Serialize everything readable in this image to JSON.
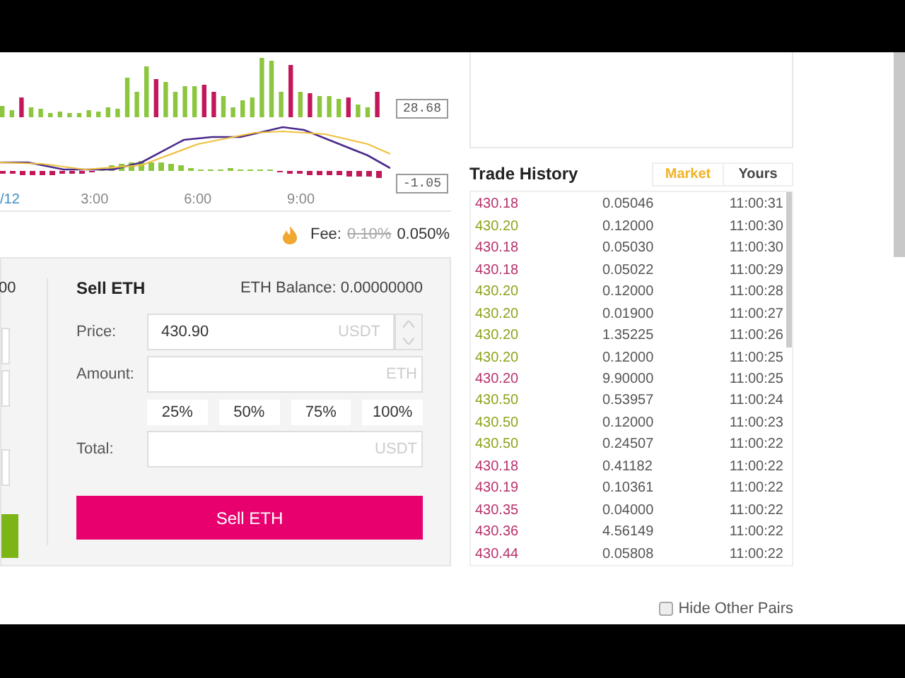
{
  "chart": {
    "price_labels": [
      "28.68",
      "-1.05"
    ],
    "time_labels": [
      "/12",
      "3:00",
      "6:00",
      "9:00"
    ]
  },
  "fee": {
    "label": "Fee:",
    "old": "0.10%",
    "new": "0.050%"
  },
  "buy": {
    "balance_fragment": "00"
  },
  "sell": {
    "title": "Sell ETH",
    "balance": "ETH Balance: 0.00000000",
    "price_label": "Price:",
    "price_value": "430.90",
    "price_unit": "USDT",
    "amount_label": "Amount:",
    "amount_unit": "ETH",
    "percents": [
      "25%",
      "50%",
      "75%",
      "100%"
    ],
    "total_label": "Total:",
    "total_unit": "USDT",
    "button": "Sell ETH"
  },
  "trade_history": {
    "title": "Trade History",
    "tabs": [
      {
        "label": "Market",
        "selected": true
      },
      {
        "label": "Yours",
        "selected": false
      }
    ],
    "rows": [
      {
        "price": "430.18",
        "amount": "0.05046",
        "time": "11:00:31",
        "color": "#b8326e"
      },
      {
        "price": "430.20",
        "amount": "0.12000",
        "time": "11:00:30",
        "color": "#8ea31c"
      },
      {
        "price": "430.18",
        "amount": "0.05030",
        "time": "11:00:30",
        "color": "#b8326e"
      },
      {
        "price": "430.18",
        "amount": "0.05022",
        "time": "11:00:29",
        "color": "#b8326e"
      },
      {
        "price": "430.20",
        "amount": "0.12000",
        "time": "11:00:28",
        "color": "#8ea31c"
      },
      {
        "price": "430.20",
        "amount": "0.01900",
        "time": "11:00:27",
        "color": "#8ea31c"
      },
      {
        "price": "430.20",
        "amount": "1.35225",
        "time": "11:00:26",
        "color": "#8ea31c"
      },
      {
        "price": "430.20",
        "amount": "0.12000",
        "time": "11:00:25",
        "color": "#8ea31c"
      },
      {
        "price": "430.20",
        "amount": "9.90000",
        "time": "11:00:25",
        "color": "#b8326e"
      },
      {
        "price": "430.50",
        "amount": "0.53957",
        "time": "11:00:24",
        "color": "#8ea31c"
      },
      {
        "price": "430.50",
        "amount": "0.12000",
        "time": "11:00:23",
        "color": "#8ea31c"
      },
      {
        "price": "430.50",
        "amount": "0.24507",
        "time": "11:00:22",
        "color": "#8ea31c"
      },
      {
        "price": "430.18",
        "amount": "0.41182",
        "time": "11:00:22",
        "color": "#b8326e"
      },
      {
        "price": "430.19",
        "amount": "0.10361",
        "time": "11:00:22",
        "color": "#b8326e"
      },
      {
        "price": "430.35",
        "amount": "0.04000",
        "time": "11:00:22",
        "color": "#b8326e"
      },
      {
        "price": "430.36",
        "amount": "4.56149",
        "time": "11:00:22",
        "color": "#b8326e"
      },
      {
        "price": "430.44",
        "amount": "0.05808",
        "time": "11:00:22",
        "color": "#b8326e"
      }
    ]
  },
  "hide_other_pairs": {
    "label": "Hide Other Pairs",
    "checked": false
  }
}
